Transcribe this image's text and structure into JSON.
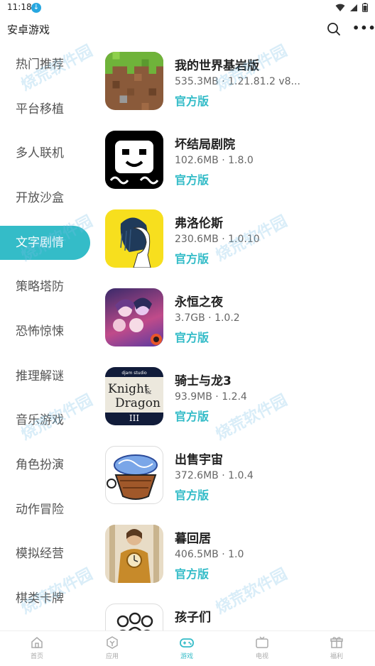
{
  "status_bar": {
    "time": "11:18"
  },
  "app_bar": {
    "title": "安卓游戏"
  },
  "sidebar": {
    "items": [
      {
        "label": "热门推荐",
        "active": false
      },
      {
        "label": "平台移植",
        "active": false
      },
      {
        "label": "多人联机",
        "active": false
      },
      {
        "label": "开放沙盒",
        "active": false
      },
      {
        "label": "文字剧情",
        "active": true
      },
      {
        "label": "策略塔防",
        "active": false
      },
      {
        "label": "恐怖惊悚",
        "active": false
      },
      {
        "label": "推理解谜",
        "active": false
      },
      {
        "label": "音乐游戏",
        "active": false
      },
      {
        "label": "角色扮演",
        "active": false
      },
      {
        "label": "动作冒险",
        "active": false
      },
      {
        "label": "模拟经营",
        "active": false
      },
      {
        "label": "棋类卡牌",
        "active": false
      }
    ]
  },
  "games": [
    {
      "name": "我的世界基岩版",
      "meta": "535.3MB · 1.21.81.2 v8...",
      "badge": "官方版"
    },
    {
      "name": "坏结局剧院",
      "meta": "102.6MB · 1.8.0",
      "badge": "官方版"
    },
    {
      "name": "弗洛伦斯",
      "meta": "230.6MB · 1.0.10",
      "badge": "官方版"
    },
    {
      "name": "永恒之夜",
      "meta": "3.7GB · 1.0.2",
      "badge": "官方版"
    },
    {
      "name": "骑士与龙3",
      "meta": "93.9MB · 1.2.4",
      "badge": "官方版",
      "icon_text": {
        "top": "djam studio",
        "main1": "Knight",
        "amp": "&",
        "main2": "Dragon",
        "num": "III"
      }
    },
    {
      "name": "出售宇宙",
      "meta": "372.6MB · 1.0.4",
      "badge": "官方版"
    },
    {
      "name": "暮回居",
      "meta": "406.5MB · 1.0",
      "badge": "官方版"
    },
    {
      "name": "孩子们",
      "meta": "",
      "badge": ""
    }
  ],
  "watermark": "烧荒软件园",
  "bottom_nav": {
    "items": [
      {
        "label": "首页",
        "icon": "home-icon",
        "active": false
      },
      {
        "label": "应用",
        "icon": "app-icon",
        "active": false
      },
      {
        "label": "游戏",
        "icon": "gamepad-icon",
        "active": true
      },
      {
        "label": "电视",
        "icon": "tv-icon",
        "active": false
      },
      {
        "label": "福利",
        "icon": "gift-icon",
        "active": false
      }
    ]
  },
  "colors": {
    "accent": "#34bcc8",
    "text": "#222222",
    "muted": "#666666"
  }
}
